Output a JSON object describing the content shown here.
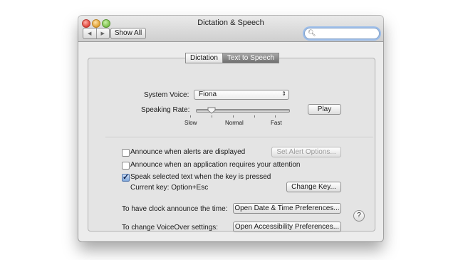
{
  "window": {
    "title": "Dictation & Speech",
    "show_all": "Show All",
    "search_placeholder": ""
  },
  "tabs": [
    {
      "label": "Dictation",
      "active": false
    },
    {
      "label": "Text to Speech",
      "active": true
    }
  ],
  "voice": {
    "system_voice_label": "System Voice:",
    "system_voice_value": "Fiona",
    "speaking_rate_label": "Speaking Rate:",
    "rate_slow": "Slow",
    "rate_normal": "Normal",
    "rate_fast": "Fast",
    "play_label": "Play"
  },
  "options": {
    "announce_alerts": {
      "label": "Announce when alerts are displayed",
      "checked": false
    },
    "set_alert_options": "Set Alert Options...",
    "announce_app": {
      "label": "Announce when an application requires your attention",
      "checked": false
    },
    "speak_selected": {
      "label": "Speak selected text when the key is pressed",
      "checked": true
    },
    "current_key": "Current key: Option+Esc",
    "change_key": "Change Key..."
  },
  "links": {
    "clock_label": "To have clock announce the time:",
    "clock_button": "Open Date & Time Preferences...",
    "voiceover_label": "To change VoiceOver settings:",
    "voiceover_button": "Open Accessibility Preferences..."
  },
  "help": "?"
}
